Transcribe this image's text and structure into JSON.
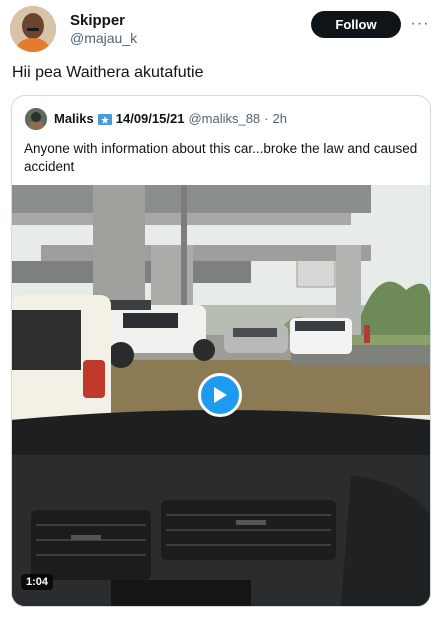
{
  "author": {
    "name": "Skipper",
    "handle": "@majau_k"
  },
  "follow_label": "Follow",
  "more_icon": "more-icon",
  "tweet_text": "Hii pea Waithera akutafutie",
  "quote": {
    "name": "Maliks",
    "badge": "14/09/15/21",
    "handle": "@maliks_88",
    "separator": "·",
    "time": "2h",
    "text": "Anyone with information about this car...broke the law and caused accident"
  },
  "video": {
    "duration": "1:04",
    "play_icon": "play-icon"
  },
  "colors": {
    "accent": "#1d9bf0",
    "follow_bg": "#0f1419",
    "secondary_text": "#536471"
  }
}
